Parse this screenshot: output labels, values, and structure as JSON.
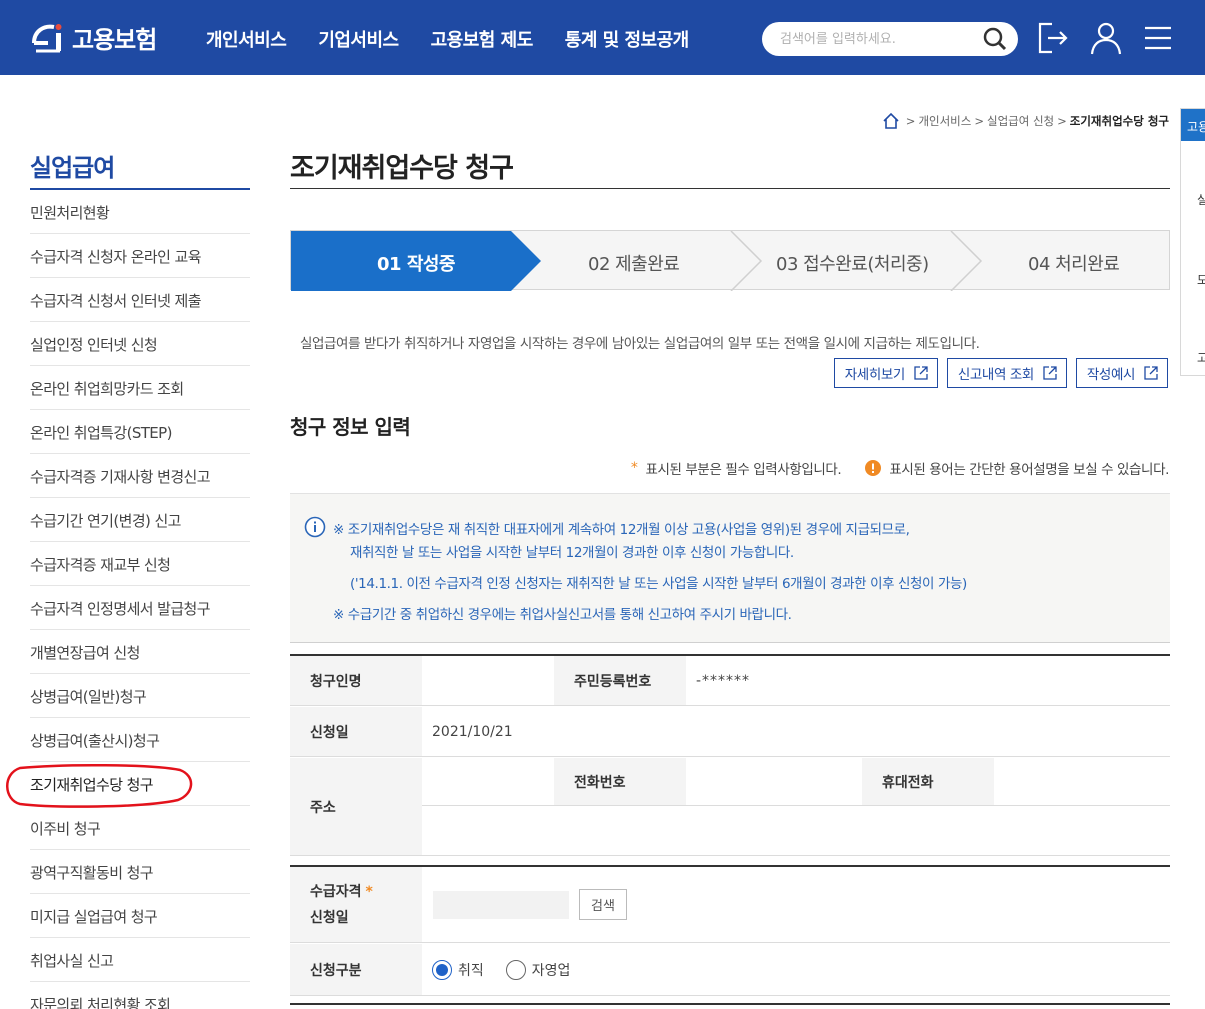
{
  "header": {
    "logo_text": "고용보험",
    "nav": [
      "개인서비스",
      "기업서비스",
      "고용보험 제도",
      "통계 및 정보공개"
    ],
    "search_placeholder": "검색어를 입력하세요."
  },
  "breadcrumb": {
    "items": [
      "개인서비스",
      "실업급여 신청"
    ],
    "current": "조기재취업수당 청구"
  },
  "right_tab": {
    "title": "고용",
    "items": [
      "실",
      "모",
      "고"
    ]
  },
  "sidebar": {
    "title": "실업급여",
    "items": [
      "민원처리현황",
      "수급자격 신청자 온라인 교육",
      "수급자격 신청서 인터넷 제출",
      "실업인정 인터넷 신청",
      "온라인 취업희망카드 조회",
      "온라인 취업특강(STEP)",
      "수급자격증 기재사항 변경신고",
      "수급기간 연기(변경) 신고",
      "수급자격증 재교부 신청",
      "수급자격 인정명세서 발급청구",
      "개별연장급여 신청",
      "상병급여(일반)청구",
      "상병급여(출산시)청구",
      "조기재취업수당 청구",
      "이주비 청구",
      "광역구직활동비 청구",
      "미지급 실업급여 청구",
      "취업사실 신고",
      "자문의뢰 처리현황 조회"
    ],
    "active_index": 13
  },
  "page": {
    "title": "조기재취업수당 청구",
    "steps": [
      "01 작성중",
      "02 제출완료",
      "03 접수완료(처리중)",
      "04 처리완료"
    ],
    "active_step": 0,
    "description": "실업급여를 받다가 취직하거나 자영업을 시작하는 경우에 남아있는 실업급여의 일부 또는 전액을 일시에 지급하는 제도입니다.",
    "link_buttons": [
      "자세히보기",
      "신고내역 조회",
      "작성예시"
    ],
    "section_title": "청구 정보 입력",
    "legend_required": "표시된 부분은 필수 입력사항입니다.",
    "legend_term": "표시된 용어는 간단한 용어설명을 보실 수 있습니다.",
    "notice": [
      "※ 조기재취업수당은 재 취직한 대표자에게 계속하여 12개월 이상 고용(사업을 영위)된 경우에 지급되므로,",
      "재취직한 날 또는 사업을 시작한 날부터 12개월이 경과한 이후 신청이 가능합니다.",
      "('14.1.1. 이전 수급자격 인정 신청자는 재취직한 날 또는 사업을 시작한 날부터 6개월이 경과한 이후 신청이 가능)",
      "※ 수급기간 중 취업하신 경우에는 취업사실신고서를 통해 신고하여 주시기 바랍니다."
    ]
  },
  "form": {
    "claimant_label": "청구인명",
    "claimant_value": "",
    "rrn_label": "주민등록번호",
    "rrn_value": "-******",
    "apply_date_label": "신청일",
    "apply_date_value": "2021/10/21",
    "address_label": "주소",
    "phone_label": "전화번호",
    "mobile_label": "휴대전화",
    "qual_date_label_1": "수급자격",
    "qual_date_label_2": "신청일",
    "search_button": "검색",
    "apply_type_label": "신청구분",
    "apply_type_options": [
      "취직",
      "자영업"
    ],
    "apply_type_selected": "취직"
  },
  "colors": {
    "brand": "#1f4aa3",
    "step_active": "#1a6fc9",
    "notice_text": "#2a66b8",
    "required": "#f08a24",
    "annotation": "#e3121b"
  }
}
